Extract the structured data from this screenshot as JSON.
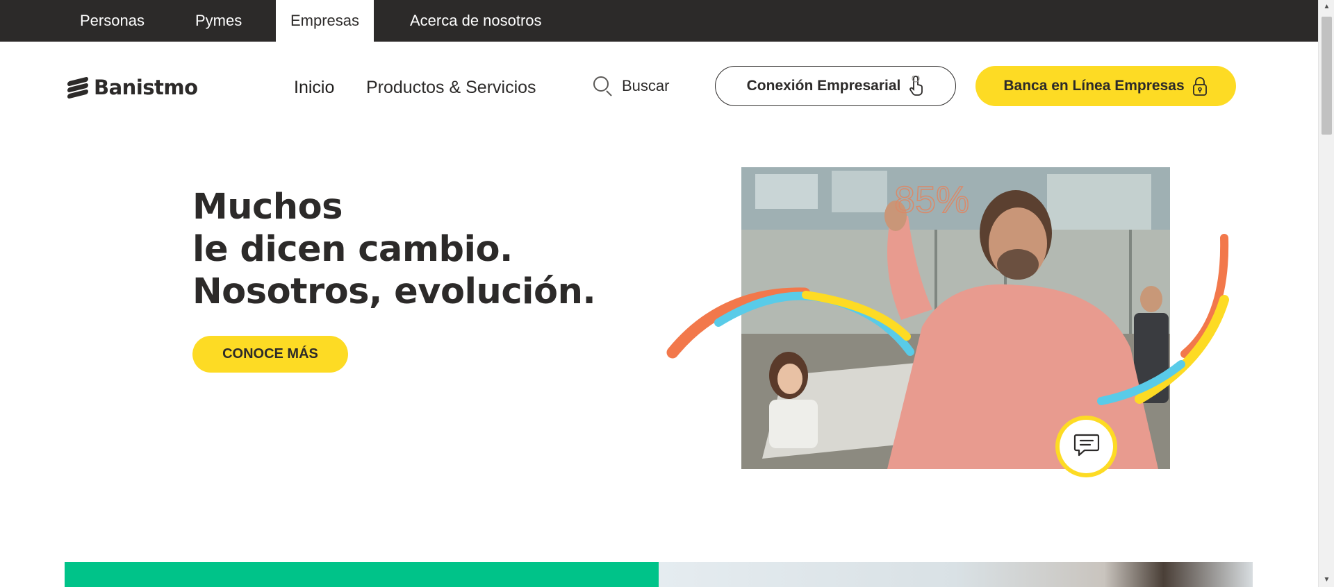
{
  "segments": [
    {
      "label": "Personas"
    },
    {
      "label": "Pymes"
    },
    {
      "label": "Empresas"
    },
    {
      "label": "Acerca de nosotros"
    }
  ],
  "active_segment": "Empresas",
  "header": {
    "logo_text": "Banistmo",
    "nav": [
      {
        "label": "Inicio"
      },
      {
        "label": "Productos & Servicios"
      }
    ],
    "search_label": "Buscar",
    "conexion_button": "Conexión Empresarial",
    "banca_button": "Banca en Línea Empresas"
  },
  "hero": {
    "title_lines": [
      "Muchos",
      "le dicen cambio.",
      "Nosotros, evolución."
    ],
    "cta_label": "CONOCE MÁS"
  },
  "icons": {
    "search": "search-icon",
    "conexion": "touch-hand-icon",
    "banca": "lock-icon",
    "chat": "chat-icon"
  },
  "colors": {
    "dark": "#2c2a29",
    "yellow": "#fddb24",
    "green": "#00c389",
    "orange": "#f2784b",
    "blue": "#59cbe8"
  }
}
